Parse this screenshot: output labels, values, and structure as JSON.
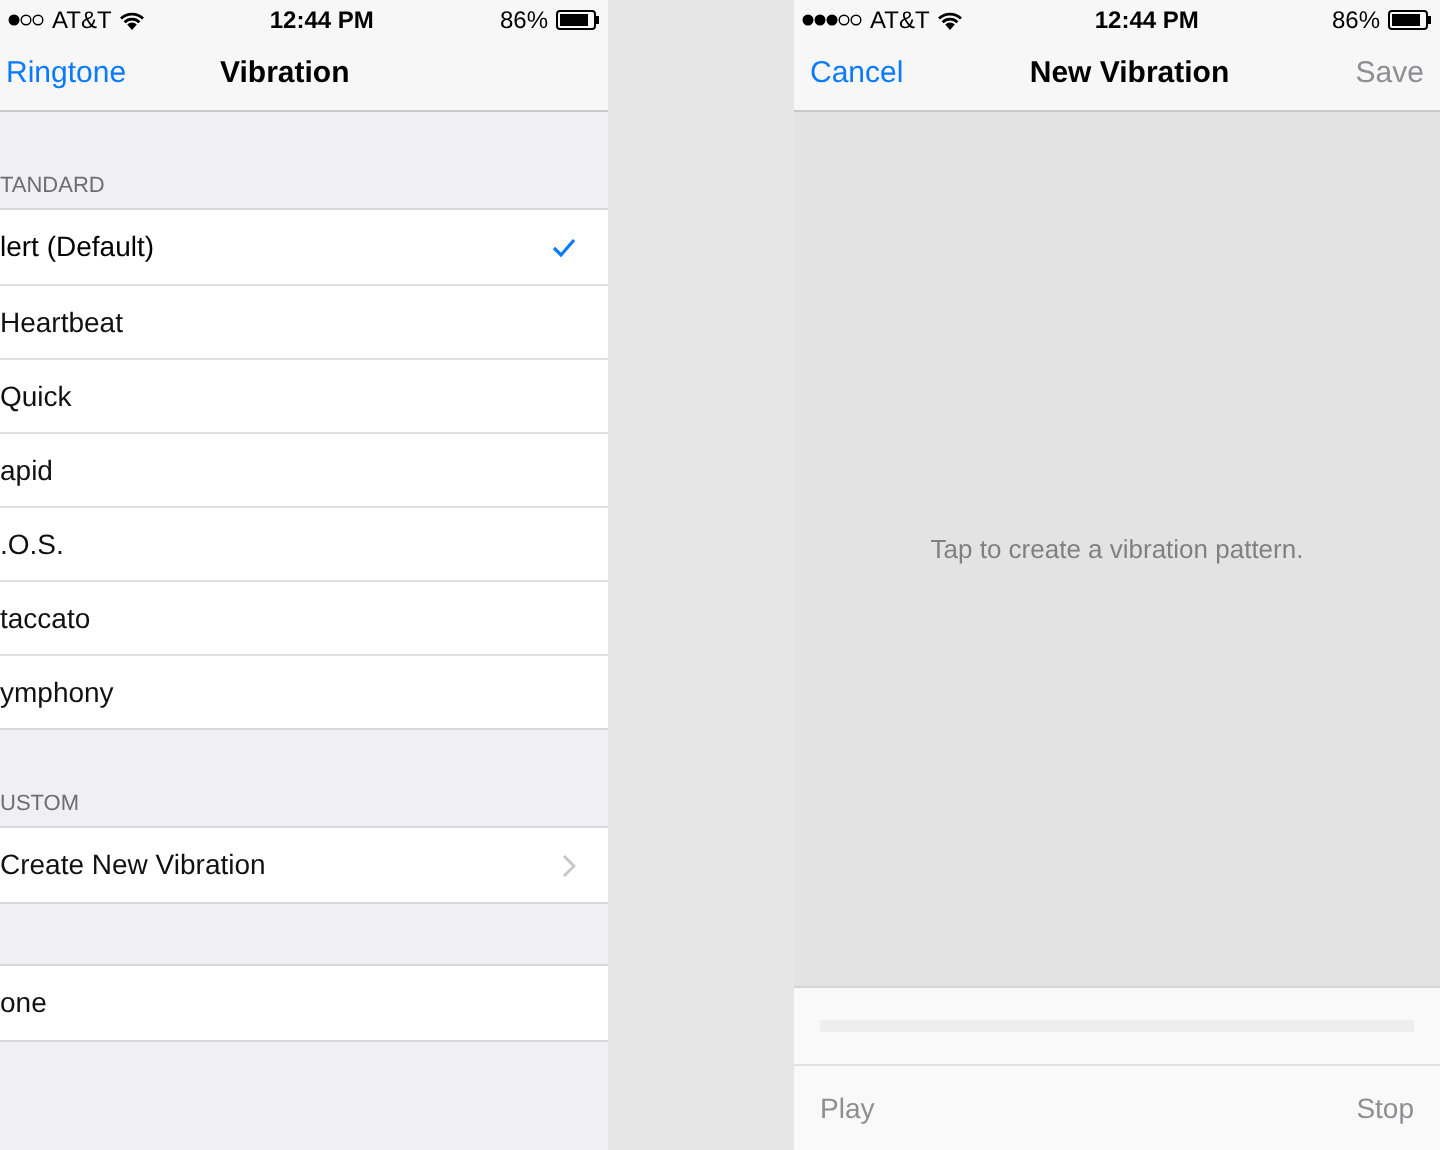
{
  "left_screen": {
    "status_bar": {
      "carrier": "AT&T",
      "time": "12:44 PM",
      "battery": "86%"
    },
    "nav": {
      "back": "Ringtone",
      "title": "Vibration"
    },
    "sections": [
      {
        "header": "TANDARD",
        "items": [
          {
            "label": "lert (Default)",
            "selected": true
          },
          {
            "label": "Heartbeat",
            "selected": false
          },
          {
            "label": "Quick",
            "selected": false
          },
          {
            "label": "apid",
            "selected": false
          },
          {
            "label": ".O.S.",
            "selected": false
          },
          {
            "label": "taccato",
            "selected": false
          },
          {
            "label": "ymphony",
            "selected": false
          }
        ]
      },
      {
        "header": "USTOM",
        "items": [
          {
            "label": "Create New Vibration",
            "selected": false,
            "kind": "link"
          }
        ]
      },
      {
        "items": [
          {
            "label": "one",
            "selected": false
          }
        ]
      }
    ]
  },
  "right_screen": {
    "status_bar": {
      "carrier": "AT&T",
      "time": "12:44 PM",
      "battery": "86%"
    },
    "nav": {
      "cancel": "Cancel",
      "title": "New Vibration",
      "save": "Save",
      "save_disabled": true
    },
    "hint": "Tap to create a vibration pattern.",
    "controls": {
      "play": "Play",
      "stop": "Stop",
      "disabled": true
    }
  }
}
